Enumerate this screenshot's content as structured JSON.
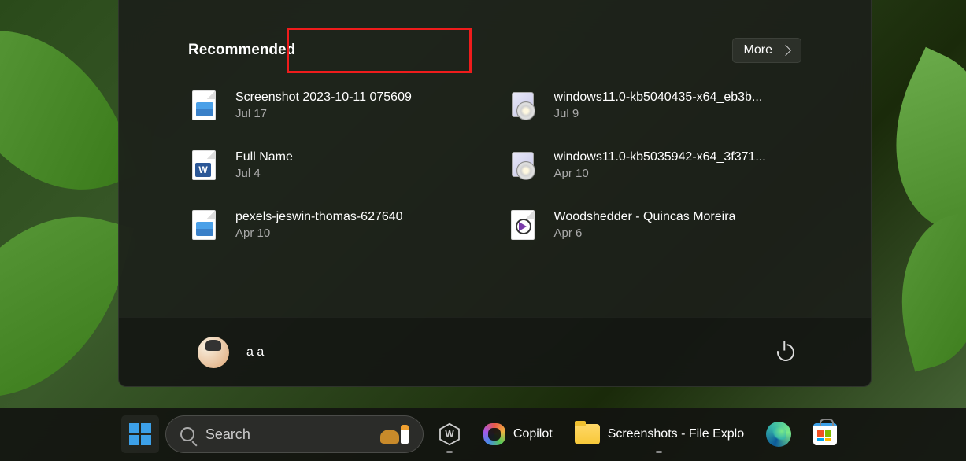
{
  "start_menu": {
    "recommended_title": "Recommended",
    "more_button": "More",
    "items": [
      {
        "name": "Screenshot 2023-10-11 075609",
        "date": "Jul 17",
        "icon": "image-file-icon"
      },
      {
        "name": "windows11.0-kb5040435-x64_eb3b...",
        "date": "Jul 9",
        "icon": "installer-file-icon"
      },
      {
        "name": "Full Name",
        "date": "Jul 4",
        "icon": "word-file-icon"
      },
      {
        "name": "windows11.0-kb5035942-x64_3f371...",
        "date": "Apr 10",
        "icon": "installer-file-icon"
      },
      {
        "name": "pexels-jeswin-thomas-627640",
        "date": "Apr 10",
        "icon": "image-file-icon"
      },
      {
        "name": "Woodshedder - Quincas Moreira",
        "date": "Apr 6",
        "icon": "media-file-icon"
      }
    ],
    "user": {
      "name": "a a"
    }
  },
  "taskbar": {
    "search_placeholder": "Search",
    "copilot_label": "Copilot",
    "explorer_label": "Screenshots - File Explo"
  },
  "annotation": {
    "highlight": "Recommended"
  }
}
